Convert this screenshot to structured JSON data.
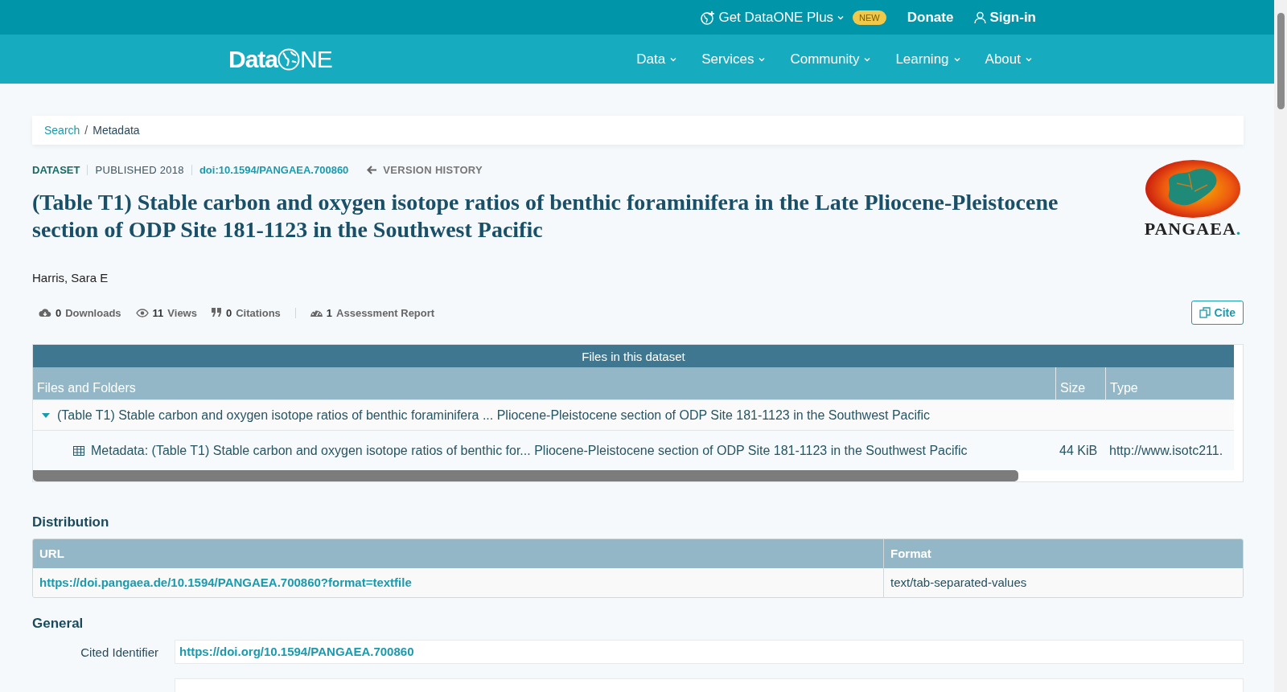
{
  "top_bar": {
    "items": [
      {
        "kind": "plus",
        "label": "Get DataONE Plus",
        "badge": "NEW"
      },
      {
        "kind": "donate",
        "label": "Donate"
      },
      {
        "kind": "signin",
        "label": "Sign-in"
      }
    ]
  },
  "nav": {
    "logo": {
      "left": "Data",
      "right": "NE"
    },
    "items": [
      "Data",
      "Services",
      "Community",
      "Learning",
      "About"
    ]
  },
  "breadcrumb": {
    "separator": "/",
    "items": [
      {
        "label": "Search",
        "link": true
      },
      {
        "label": "Metadata",
        "link": false
      }
    ]
  },
  "meta": {
    "type": "DATASET",
    "published": "PUBLISHED 2018",
    "doi": "doi:10.1594/PANGAEA.700860",
    "version_history": "VERSION HISTORY"
  },
  "title": "(Table T1) Stable carbon and oxygen isotope ratios of benthic foraminifera in the Late Pliocene-Pleistocene section of ODP Site 181-1123 in the Southwest Pacific",
  "repository_logo": {
    "text": "PANGAEA",
    "dot": "."
  },
  "author": "Harris, Sara E",
  "stats": [
    {
      "kind": "downloads",
      "count": "0",
      "label": "Downloads"
    },
    {
      "kind": "views",
      "count": "11",
      "label": "Views"
    },
    {
      "kind": "citations",
      "count": "0",
      "label": "Citations"
    },
    {
      "kind": "assessment",
      "count": "1",
      "label": "Assessment Report"
    }
  ],
  "cite_button": "Cite",
  "files_table": {
    "title": "Files in this dataset",
    "columns": [
      "Files and Folders",
      "Size",
      "Type"
    ],
    "rows": [
      {
        "name": "(Table T1) Stable carbon and oxygen isotope ratios of benthic foraminifera ... Pliocene-Pleistocene section of ODP Site 181-1123 in the Southwest Pacific",
        "expanded": true,
        "children": [
          {
            "name": "Metadata: (Table T1) Stable carbon and oxygen isotope ratios of benthic for... Pliocene-Pleistocene section of ODP Site 181-1123 in the Southwest Pacific",
            "size": "44 KiB",
            "type": "http://www.isotc211."
          }
        ]
      }
    ]
  },
  "distribution": {
    "heading": "Distribution",
    "columns": [
      "URL",
      "Format"
    ],
    "rows": [
      [
        "https://doi.pangaea.de/10.1594/PANGAEA.700860?format=textfile",
        "text/tab-separated-values"
      ]
    ]
  },
  "general": {
    "heading": "General",
    "fields": [
      {
        "label": "Cited Identifier",
        "value": "https://doi.org/10.1594/PANGAEA.700860"
      }
    ]
  }
}
